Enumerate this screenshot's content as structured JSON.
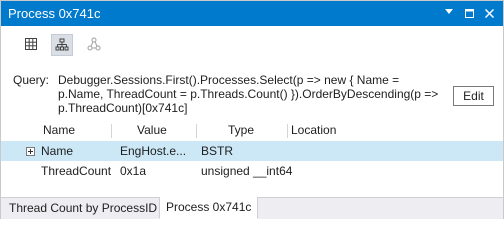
{
  "window": {
    "title": "Process 0x741c"
  },
  "title_buttons": {
    "dropdown_icon": "chevron-down-icon",
    "maximize_icon": "maximize-icon",
    "close_icon": "close-icon"
  },
  "toolbar": {
    "tools": [
      {
        "icon": "grid-view-icon",
        "selected": false
      },
      {
        "icon": "hierarchy-view-icon",
        "selected": true
      },
      {
        "icon": "graph-view-icon",
        "selected": false
      }
    ]
  },
  "query": {
    "label": "Query:",
    "text": "Debugger.Sessions.First().Processes.Select(p => new { Name = p.Name, ThreadCount = p.Threads.Count() }).OrderByDescending(p => p.ThreadCount)[0x741c]",
    "edit_label": "Edit"
  },
  "grid": {
    "columns": [
      "Name",
      "Value",
      "Type",
      "Location"
    ],
    "rows": [
      {
        "name": "Name",
        "value": "EngHost.e...",
        "type": "BSTR",
        "location": "",
        "expandable": true,
        "selected": true
      },
      {
        "name": "ThreadCount",
        "value": "0x1a",
        "type": "unsigned __int64",
        "location": "",
        "expandable": false,
        "selected": false
      }
    ]
  },
  "tabs": [
    {
      "label": "Thread Count by ProcessID",
      "active": false
    },
    {
      "label": "Process 0x741c",
      "active": true
    }
  ],
  "colors": {
    "titlebar": "#007acc",
    "selection": "#cce8f6"
  }
}
